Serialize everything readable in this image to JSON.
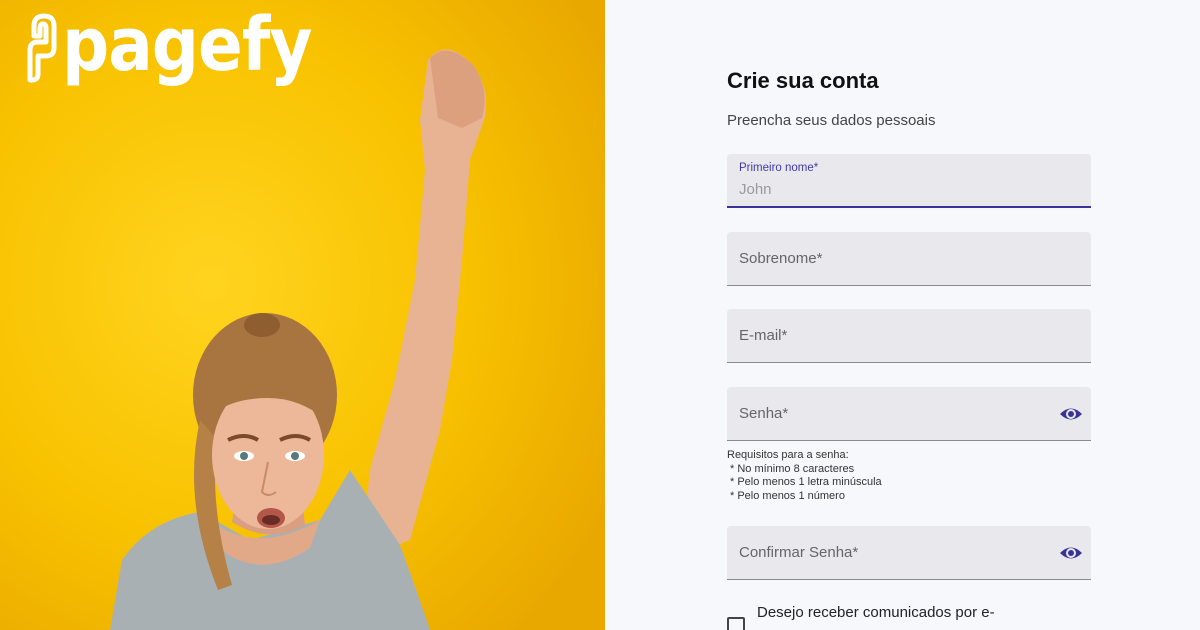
{
  "brand": {
    "name": "pagefy"
  },
  "form": {
    "title": "Crie sua conta",
    "subtitle": "Preencha seus dados pessoais",
    "fields": [
      {
        "label": "Primeiro nome",
        "required_mark": "*",
        "placeholder": "John",
        "focused": true
      },
      {
        "label": "Sobrenome",
        "required_mark": "*"
      },
      {
        "label": "E-mail",
        "required_mark": "*"
      },
      {
        "label": "Senha",
        "required_mark": "*",
        "icon": "eye-icon"
      },
      {
        "label": "Confirmar Senha",
        "required_mark": "*",
        "icon": "eye-icon"
      }
    ],
    "password_requirements": {
      "heading": "Requisitos para a senha:",
      "items": [
        " * No mínimo 8 caracteres",
        " * Pelo menos 1 letra minúscula",
        " * Pelo menos 1 número"
      ]
    },
    "newsletter_label": "Desejo receber comunicados por e-"
  },
  "colors": {
    "hero_background": "#f9c300",
    "accent": "#3a3397",
    "field_background": "#e8e8ed",
    "page_background": "#f7f8fc"
  }
}
